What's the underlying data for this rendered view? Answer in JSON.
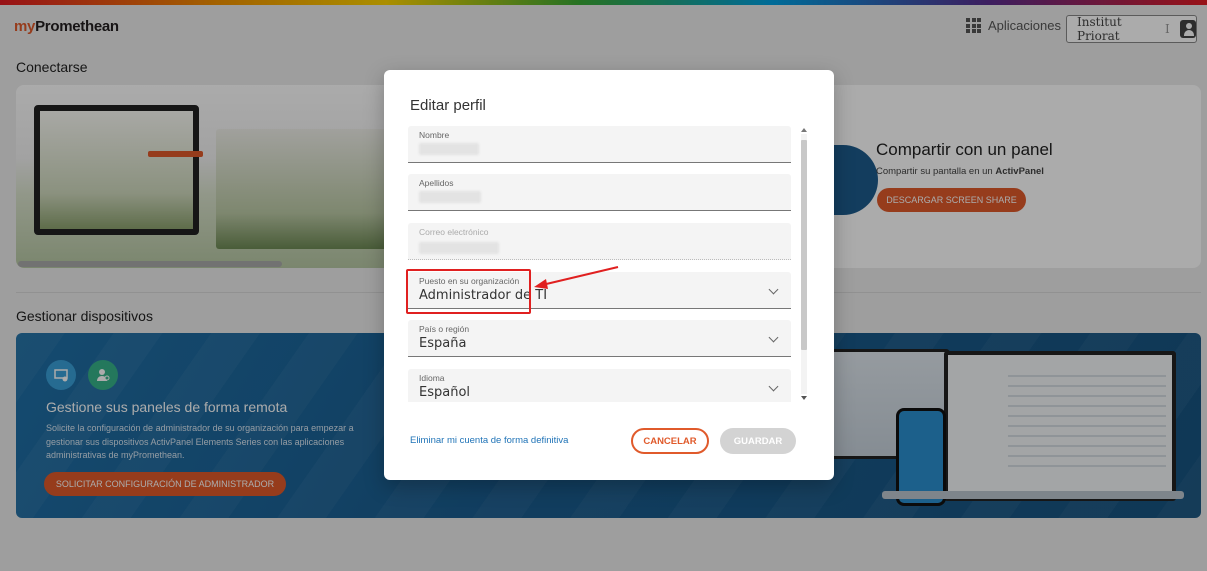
{
  "header": {
    "logo_prefix": "my",
    "logo_suffix": "Promethean",
    "apps_label": "Aplicaciones",
    "org_name": "Institut Priorat",
    "org_separator": "I"
  },
  "connect": {
    "section_title": "Conectarse",
    "share_title": "Compartir con un panel",
    "share_sub_prefix": "Compartir su pantalla en un ",
    "share_sub_brand": "ActivPanel",
    "download_button": "DESCARGAR SCREEN SHARE"
  },
  "manage": {
    "section_title": "Gestionar dispositivos",
    "title": "Gestione sus paneles de forma remota",
    "description": "Solicite la configuración de administrador de su organización para empezar a gestionar sus dispositivos ActivPanel Elements Series con las aplicaciones administrativas de myPromethean.",
    "request_button": "SOLICITAR CONFIGURACIÓN DE ADMINISTRADOR"
  },
  "modal": {
    "title": "Editar perfil",
    "fields": [
      {
        "label": "Nombre",
        "value": ""
      },
      {
        "label": "Apellidos",
        "value": ""
      },
      {
        "label": "Correo electrónico",
        "value": ""
      },
      {
        "label": "Puesto en su organización",
        "value": "Administrador de TI"
      },
      {
        "label": "País o región",
        "value": "España"
      },
      {
        "label": "Idioma",
        "value": "Español"
      }
    ],
    "delete_link": "Eliminar mi cuenta de forma definitiva",
    "cancel_button": "CANCELAR",
    "save_button": "GUARDAR"
  },
  "colors": {
    "accent": "#e05a2b",
    "link": "#1f73b7",
    "highlight": "#e02020",
    "banner": "#1a5c8e"
  }
}
